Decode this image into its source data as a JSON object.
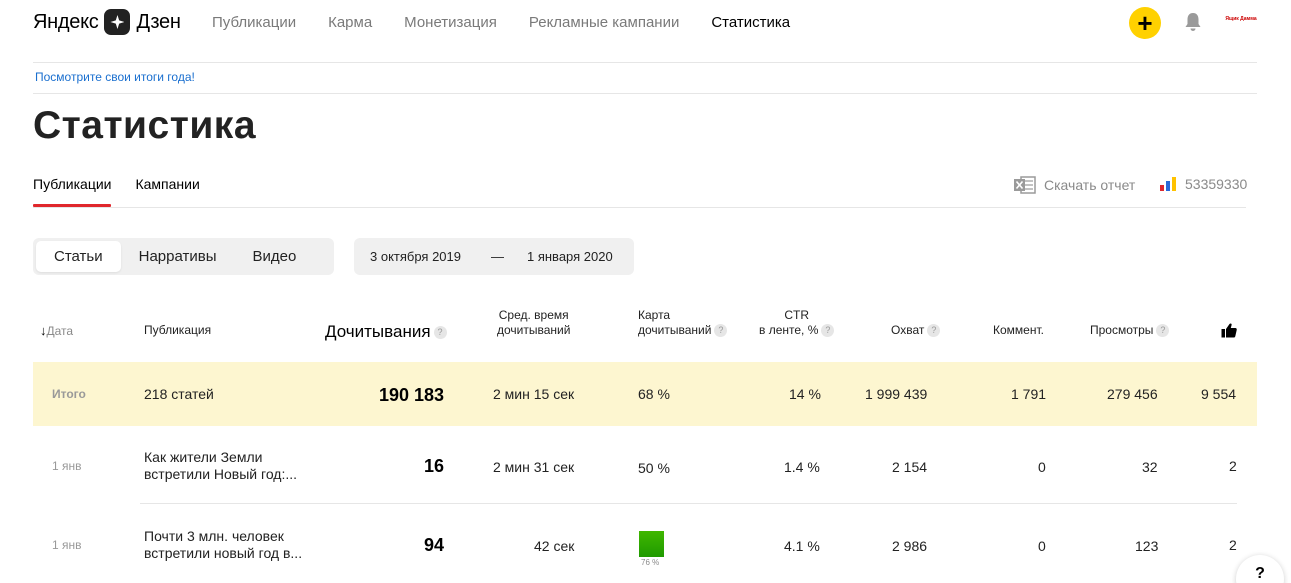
{
  "header": {
    "logo_left": "Яндекс",
    "logo_right": "Дзен",
    "nav": [
      "Публикации",
      "Карма",
      "Монетизация",
      "Рекламные кампании",
      "Статистика"
    ],
    "avatar_text": "Ящик Дамма"
  },
  "banner": {
    "text": "Посмотрите свои итоги года!"
  },
  "page": {
    "title": "Статистика"
  },
  "subtabs": [
    "Публикации",
    "Кампании"
  ],
  "tools": {
    "download": "Скачать отчет",
    "counter": "53359330"
  },
  "content_types": [
    "Статьи",
    "Нарративы",
    "Видео"
  ],
  "daterange": {
    "from": "3 октября 2019",
    "dash": "—",
    "to": "1 января 2020"
  },
  "table": {
    "headers": {
      "date": "Дата",
      "publication": "Публикация",
      "reads": "Дочитывания",
      "avg_time_1": "Сред. время",
      "avg_time_2": "дочитываний",
      "map_1": "Карта",
      "map_2": "дочитываний",
      "ctr_1": "CTR",
      "ctr_2": "в ленте, %",
      "reach": "Охват",
      "comments": "Коммент.",
      "views": "Просмотры",
      "help_mark": "?"
    },
    "total": {
      "label": "Итого",
      "publication": "218 статей",
      "reads": "190 183",
      "avg_time": "2 мин 15 сек",
      "map": "68 %",
      "ctr": "14 %",
      "reach": "1 999 439",
      "comments": "1 791",
      "views": "279 456",
      "likes": "9 554"
    },
    "rows": [
      {
        "date": "1 янв",
        "title_line1": "Как жители Земли",
        "title_line2": "встретили Новый год:...",
        "reads": "16",
        "avg_time": "2 мин 31 сек",
        "map": "50 %",
        "ctr": "1.4 %",
        "reach": "2 154",
        "comments": "0",
        "views": "32",
        "likes": "2"
      },
      {
        "date": "1 янв",
        "title_line1": "Почти 3 млн. человек",
        "title_line2": "встретили новый год в...",
        "reads": "94",
        "avg_time": "42 сек",
        "map_label": "76 %",
        "ctr": "4.1 %",
        "reach": "2 986",
        "comments": "0",
        "views": "123",
        "likes": "2"
      }
    ]
  },
  "help_button": "?",
  "colors": {
    "accent_yellow": "#ffd100",
    "tab_underline": "#e0272c",
    "total_bg": "#fdf6d0",
    "link": "#1a6fcf",
    "heatmap_green": "#2fa800"
  }
}
